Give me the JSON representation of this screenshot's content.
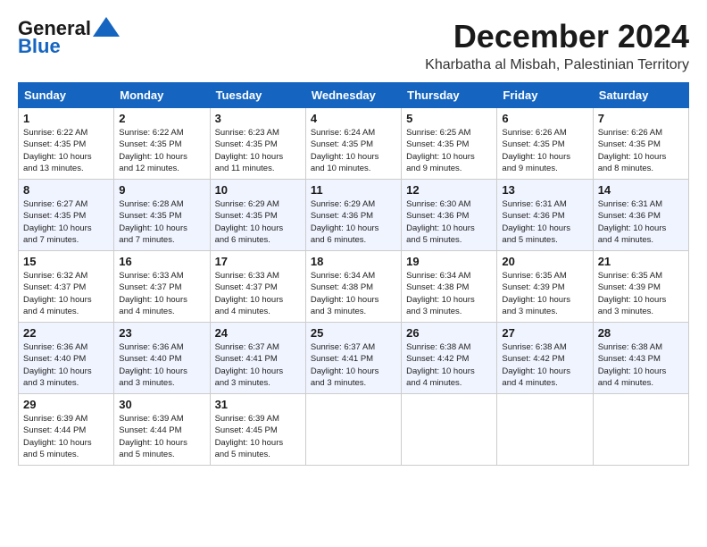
{
  "logo": {
    "line1": "General",
    "line2": "Blue"
  },
  "title": "December 2024",
  "location": "Kharbatha al Misbah, Palestinian Territory",
  "days_header": [
    "Sunday",
    "Monday",
    "Tuesday",
    "Wednesday",
    "Thursday",
    "Friday",
    "Saturday"
  ],
  "weeks": [
    [
      {
        "day": "1",
        "info": "Sunrise: 6:22 AM\nSunset: 4:35 PM\nDaylight: 10 hours\nand 13 minutes."
      },
      {
        "day": "2",
        "info": "Sunrise: 6:22 AM\nSunset: 4:35 PM\nDaylight: 10 hours\nand 12 minutes."
      },
      {
        "day": "3",
        "info": "Sunrise: 6:23 AM\nSunset: 4:35 PM\nDaylight: 10 hours\nand 11 minutes."
      },
      {
        "day": "4",
        "info": "Sunrise: 6:24 AM\nSunset: 4:35 PM\nDaylight: 10 hours\nand 10 minutes."
      },
      {
        "day": "5",
        "info": "Sunrise: 6:25 AM\nSunset: 4:35 PM\nDaylight: 10 hours\nand 9 minutes."
      },
      {
        "day": "6",
        "info": "Sunrise: 6:26 AM\nSunset: 4:35 PM\nDaylight: 10 hours\nand 9 minutes."
      },
      {
        "day": "7",
        "info": "Sunrise: 6:26 AM\nSunset: 4:35 PM\nDaylight: 10 hours\nand 8 minutes."
      }
    ],
    [
      {
        "day": "8",
        "info": "Sunrise: 6:27 AM\nSunset: 4:35 PM\nDaylight: 10 hours\nand 7 minutes."
      },
      {
        "day": "9",
        "info": "Sunrise: 6:28 AM\nSunset: 4:35 PM\nDaylight: 10 hours\nand 7 minutes."
      },
      {
        "day": "10",
        "info": "Sunrise: 6:29 AM\nSunset: 4:35 PM\nDaylight: 10 hours\nand 6 minutes."
      },
      {
        "day": "11",
        "info": "Sunrise: 6:29 AM\nSunset: 4:36 PM\nDaylight: 10 hours\nand 6 minutes."
      },
      {
        "day": "12",
        "info": "Sunrise: 6:30 AM\nSunset: 4:36 PM\nDaylight: 10 hours\nand 5 minutes."
      },
      {
        "day": "13",
        "info": "Sunrise: 6:31 AM\nSunset: 4:36 PM\nDaylight: 10 hours\nand 5 minutes."
      },
      {
        "day": "14",
        "info": "Sunrise: 6:31 AM\nSunset: 4:36 PM\nDaylight: 10 hours\nand 4 minutes."
      }
    ],
    [
      {
        "day": "15",
        "info": "Sunrise: 6:32 AM\nSunset: 4:37 PM\nDaylight: 10 hours\nand 4 minutes."
      },
      {
        "day": "16",
        "info": "Sunrise: 6:33 AM\nSunset: 4:37 PM\nDaylight: 10 hours\nand 4 minutes."
      },
      {
        "day": "17",
        "info": "Sunrise: 6:33 AM\nSunset: 4:37 PM\nDaylight: 10 hours\nand 4 minutes."
      },
      {
        "day": "18",
        "info": "Sunrise: 6:34 AM\nSunset: 4:38 PM\nDaylight: 10 hours\nand 3 minutes."
      },
      {
        "day": "19",
        "info": "Sunrise: 6:34 AM\nSunset: 4:38 PM\nDaylight: 10 hours\nand 3 minutes."
      },
      {
        "day": "20",
        "info": "Sunrise: 6:35 AM\nSunset: 4:39 PM\nDaylight: 10 hours\nand 3 minutes."
      },
      {
        "day": "21",
        "info": "Sunrise: 6:35 AM\nSunset: 4:39 PM\nDaylight: 10 hours\nand 3 minutes."
      }
    ],
    [
      {
        "day": "22",
        "info": "Sunrise: 6:36 AM\nSunset: 4:40 PM\nDaylight: 10 hours\nand 3 minutes."
      },
      {
        "day": "23",
        "info": "Sunrise: 6:36 AM\nSunset: 4:40 PM\nDaylight: 10 hours\nand 3 minutes."
      },
      {
        "day": "24",
        "info": "Sunrise: 6:37 AM\nSunset: 4:41 PM\nDaylight: 10 hours\nand 3 minutes."
      },
      {
        "day": "25",
        "info": "Sunrise: 6:37 AM\nSunset: 4:41 PM\nDaylight: 10 hours\nand 3 minutes."
      },
      {
        "day": "26",
        "info": "Sunrise: 6:38 AM\nSunset: 4:42 PM\nDaylight: 10 hours\nand 4 minutes."
      },
      {
        "day": "27",
        "info": "Sunrise: 6:38 AM\nSunset: 4:42 PM\nDaylight: 10 hours\nand 4 minutes."
      },
      {
        "day": "28",
        "info": "Sunrise: 6:38 AM\nSunset: 4:43 PM\nDaylight: 10 hours\nand 4 minutes."
      }
    ],
    [
      {
        "day": "29",
        "info": "Sunrise: 6:39 AM\nSunset: 4:44 PM\nDaylight: 10 hours\nand 5 minutes."
      },
      {
        "day": "30",
        "info": "Sunrise: 6:39 AM\nSunset: 4:44 PM\nDaylight: 10 hours\nand 5 minutes."
      },
      {
        "day": "31",
        "info": "Sunrise: 6:39 AM\nSunset: 4:45 PM\nDaylight: 10 hours\nand 5 minutes."
      },
      null,
      null,
      null,
      null
    ]
  ]
}
